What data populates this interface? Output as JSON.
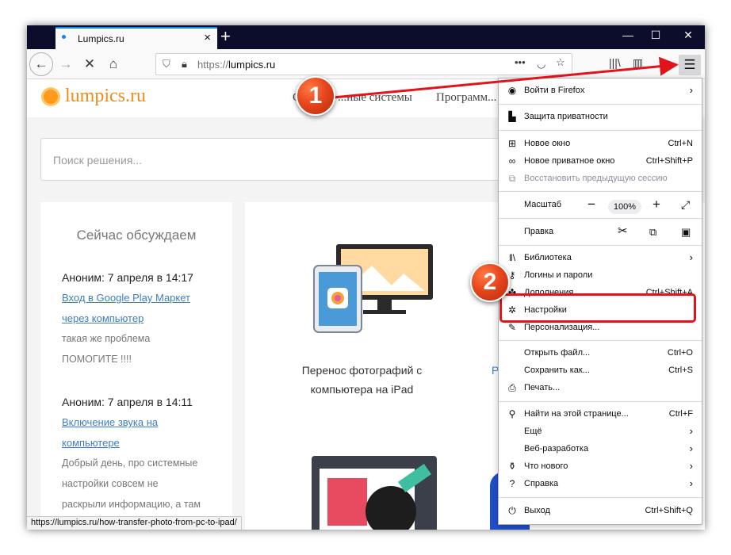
{
  "browser": {
    "tab_title": "Lumpics.ru",
    "url_scheme": "https://",
    "url_host": "lumpics.ru",
    "accent": "#0a84ff"
  },
  "site": {
    "name": "lumpics.ru",
    "nav": [
      "О...",
      "...ные системы",
      "Программ..."
    ],
    "search_placeholder": "Поиск решения...",
    "sidebar_title": "Сейчас обсуждаем",
    "comments": [
      {
        "author": "Аноним: 7 апреля в 14:17",
        "link_lines": [
          "Вход в Google Play Маркет",
          "через компьютер"
        ],
        "text_lines": [
          "такая же проблема",
          "ПОМОГИТЕ !!!!"
        ]
      },
      {
        "author": "Аноним: 7 апреля в 14:11",
        "link_lines": [
          "Включение звука на",
          "компьютере"
        ],
        "text_lines": [
          "Добрый день, про системные",
          "настройки совсем не",
          "раскрыли информацию, а там"
        ]
      }
    ],
    "article1_title_lines": [
      "Перенос фотографий с",
      "компьютера на iPad"
    ],
    "article2_title_fragment": "P",
    "status_url": "https://lumpics.ru/how-transfer-photo-from-pc-to-ipad/"
  },
  "menu": {
    "signin": "Войти в Firefox",
    "privacy": "Защита приватности",
    "new_window": "Новое окно",
    "new_window_sc": "Ctrl+N",
    "private_window": "Новое приватное окно",
    "private_window_sc": "Ctrl+Shift+P",
    "restore_session": "Восстановить предыдущую сессию",
    "zoom_label": "Масштаб",
    "zoom_value": "100%",
    "edit_label": "Правка",
    "library": "Библиотека",
    "logins": "Логины и пароли",
    "addons_partial": "Дополнения",
    "addons_sc": "Ctrl+Shift+A",
    "settings": "Настройки",
    "customize": "Персонализация...",
    "open_file": "Открыть файл...",
    "open_file_sc": "Ctrl+O",
    "save_as": "Сохранить как...",
    "save_as_sc": "Ctrl+S",
    "print": "Печать...",
    "find": "Найти на этой странице...",
    "find_sc": "Ctrl+F",
    "more": "Ещё",
    "web_dev": "Веб-разработка",
    "whats_new": "Что нового",
    "help": "Справка",
    "exit": "Выход",
    "exit_sc": "Ctrl+Shift+Q"
  },
  "annotations": {
    "badge1": "1",
    "badge2": "2",
    "color": "#e0141a"
  }
}
